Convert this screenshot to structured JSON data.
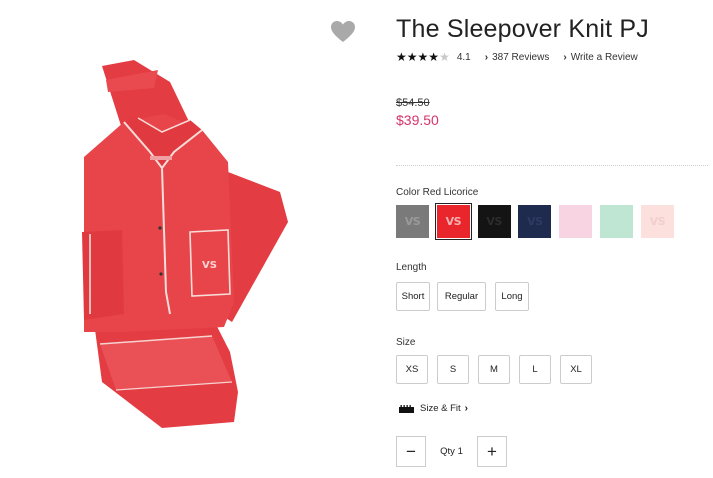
{
  "product": {
    "title": "The Sleepover Knit PJ",
    "rating_value": "4.1",
    "rating_stars": 4,
    "rating_max": 5,
    "reviews_label": "387 Reviews",
    "write_review_label": "Write a Review",
    "price_original": "$54.50",
    "price_sale": "$39.50",
    "pocket_logo": "VS"
  },
  "color": {
    "label": "Color Red Licorice",
    "swatches": [
      {
        "name": "Grey",
        "hex": "#7a7a7a",
        "logo": "VS",
        "logo_color": "#9a9a9a"
      },
      {
        "name": "Red Licorice",
        "hex": "#e8262b",
        "logo": "VS",
        "logo_color": "#f5b0b0",
        "selected": true
      },
      {
        "name": "Black",
        "hex": "#141414",
        "logo": "VS",
        "logo_color": "#2c2c2c"
      },
      {
        "name": "Navy",
        "hex": "#1f2b4e",
        "logo": "VS",
        "logo_color": "#2e3b61"
      },
      {
        "name": "Pink",
        "hex": "#f8d4e3",
        "logo": "",
        "logo_color": "#f8d4e3"
      },
      {
        "name": "Mint",
        "hex": "#bfe6d2",
        "logo": "",
        "logo_color": "#bfe6d2"
      },
      {
        "name": "Blush",
        "hex": "#fbe0de",
        "logo": "VS",
        "logo_color": "#f3cfcc"
      }
    ]
  },
  "length": {
    "label": "Length",
    "options": [
      "Short",
      "Regular",
      "Long"
    ]
  },
  "size": {
    "label": "Size",
    "options": [
      "XS",
      "S",
      "M",
      "L",
      "XL"
    ],
    "fit_link": "Size & Fit"
  },
  "quantity": {
    "minus": "−",
    "label": "Qty",
    "value": "1",
    "plus": "+"
  },
  "colors": {
    "sale_price": "#d6336c",
    "pajama_red": "#e8454a"
  }
}
